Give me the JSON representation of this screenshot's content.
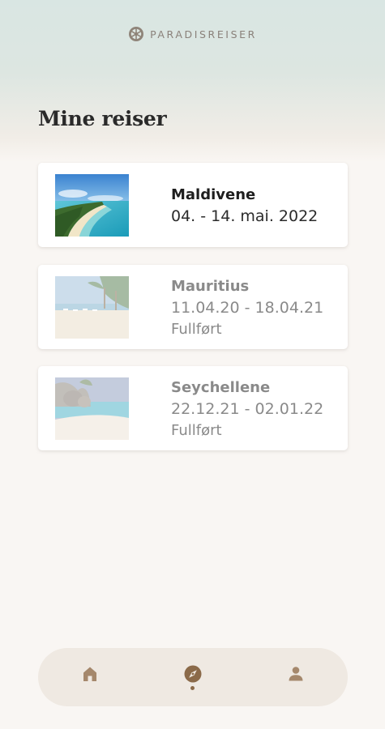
{
  "brand": {
    "name": "PARADISREISER",
    "icon": "ship-wheel-icon"
  },
  "page": {
    "title": "Mine reiser"
  },
  "trips": [
    {
      "name": "Maldivene",
      "dates": "04. - 14. mai. 2022",
      "status": "",
      "image": "maldives-island-photo"
    },
    {
      "name": "Mauritius",
      "dates": "11.04.20 - 18.04.21",
      "status": "Fullført",
      "image": "mauritius-beach-photo"
    },
    {
      "name": "Seychellene",
      "dates": "22.12.21 - 02.01.22",
      "status": "Fullført",
      "image": "seychelles-beach-photo"
    }
  ],
  "nav": {
    "items": [
      {
        "id": "home",
        "icon": "home-icon",
        "active": false
      },
      {
        "id": "explore",
        "icon": "compass-icon",
        "active": true
      },
      {
        "id": "profile",
        "icon": "person-icon",
        "active": false
      }
    ],
    "icon_color": "#a5886c",
    "active_color": "#8b6a49",
    "bar_color": "#efe9e2"
  },
  "colors": {
    "background": "#f9f6f3",
    "header_tint": "#d9e6e3",
    "muted_text": "#8a8a8a"
  }
}
